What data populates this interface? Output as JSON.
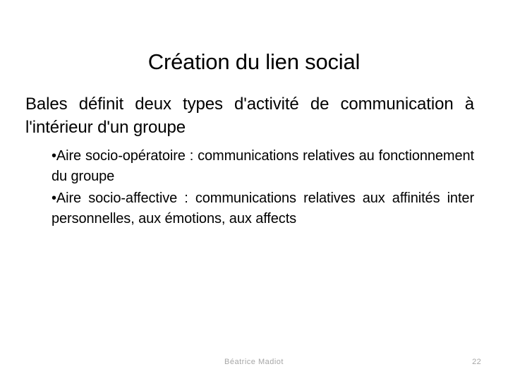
{
  "slide": {
    "title": "Création du lien social",
    "lead_paragraph": "Bales définit deux types d'activité de communication à l'intérieur d'un groupe",
    "bullets": [
      {
        "glyph": "•",
        "text": "Aire socio-opératoire : communications relatives au fonctionnement du groupe"
      },
      {
        "glyph": "•",
        "text": "Aire socio-affective : communications relatives aux affinités inter personnelles, aux émotions, aux affects"
      }
    ],
    "footer": {
      "author": "Béatrice Madiot",
      "page_number": "22"
    },
    "colors": {
      "background": "#ffffff",
      "text": "#000000",
      "footer_text": "#a6a6a6"
    }
  }
}
